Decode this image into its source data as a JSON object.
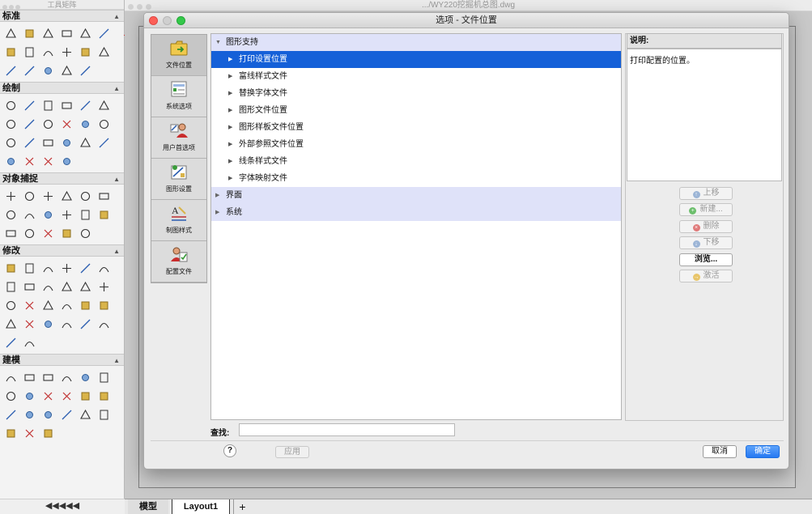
{
  "palette": {
    "title": "工具矩阵",
    "sections": [
      {
        "label": "标准",
        "rows": [
          [
            "new-file-icon",
            "open-folder-icon",
            "save-icon",
            "print-icon",
            "plot-icon",
            "print-preview-icon"
          ],
          [
            "cut-icon",
            "copy-icon",
            "paste-icon",
            "match-properties-icon",
            "undo-icon",
            "redo-icon"
          ],
          [
            "pan-icon",
            "orbit-icon",
            "zoom-realtime-icon",
            "design-center-icon",
            "block-editor-icon"
          ]
        ]
      },
      {
        "label": "绘制",
        "rows": [
          [
            "line-icon",
            "construction-line-icon",
            "circle-icon",
            "rectangle-icon",
            "revision-cloud-icon",
            "arc-icon"
          ],
          [
            "donut-icon",
            "ellipse-icon",
            "polyline-icon",
            "point-icon",
            "spline-icon",
            "multiline-icon"
          ],
          [
            "table-icon",
            "hatch-icon",
            "gradient-icon",
            "region-icon",
            "text-icon",
            "mtext-icon"
          ],
          [
            "wipeout-icon",
            "boundary-icon",
            "ellipse-arc-icon",
            "polygon-icon"
          ]
        ]
      },
      {
        "label": "对象捕捉",
        "rows": [
          [
            "snap-endpoint-icon",
            "snap-midpoint-icon",
            "snap-intersection-icon",
            "snap-apparent-icon",
            "snap-extension-icon",
            "snap-perpendicular-icon"
          ],
          [
            "snap-tangent-icon",
            "snap-center-icon",
            "snap-quadrant-icon",
            "snap-node-icon",
            "snap-insert-icon",
            "snap-nearest-icon"
          ],
          [
            "snap-parallel-icon",
            "snap-none-icon",
            "snap-from-icon",
            "snap-temp-icon",
            "snap-settings-icon"
          ]
        ]
      },
      {
        "label": "修改",
        "rows": [
          [
            "erase-icon",
            "copy-object-icon",
            "mirror-icon",
            "offset-icon",
            "array-icon",
            "fillet-icon"
          ],
          [
            "array-rect-icon",
            "move-icon",
            "rotate-icon",
            "scale-icon",
            "stretch-icon",
            "arc-edit-icon"
          ],
          [
            "trim-icon",
            "extend-icon",
            "break-icon",
            "join-icon",
            "text-edit-icon",
            "explode-icon"
          ],
          [
            "align-icon",
            "chamfer-icon",
            "hatch-edit-icon",
            "draworder-icon",
            "blend-icon",
            "smooth-icon"
          ],
          [
            "block-icon",
            "attribute-icon"
          ]
        ]
      },
      {
        "label": "建模",
        "rows": [
          [
            "box-icon",
            "cone-icon",
            "cylinder-icon",
            "pyramid-icon",
            "sphere-icon",
            "torus-icon"
          ],
          [
            "wedge-icon",
            "planar-surface-icon",
            "extrude-icon",
            "presspull-icon",
            "sweep-icon",
            "loft-icon"
          ],
          [
            "revolve-icon",
            "helix-icon",
            "union-icon",
            "subtract-icon",
            "intersect-icon",
            "section-icon"
          ],
          [
            "slice-icon",
            "interfere-icon",
            "render-icon"
          ]
        ]
      }
    ],
    "bottom": "◀◀◀◀◀"
  },
  "drawing_window": {
    "title": ".../WY220挖掘机总图.dwg",
    "tabs": {
      "model": "模型",
      "layout": "Layout1",
      "add": "+"
    }
  },
  "dialog": {
    "title": "选项 - 文件位置",
    "categories": [
      {
        "label": "文件位置",
        "icon": "folder-icon"
      },
      {
        "label": "系统选项",
        "icon": "system-options-icon"
      },
      {
        "label": "用户首选项",
        "icon": "user-preferences-icon"
      },
      {
        "label": "图形设置",
        "icon": "drawing-settings-icon"
      },
      {
        "label": "制图样式",
        "icon": "drafting-style-icon"
      },
      {
        "label": "配置文件",
        "icon": "profile-icon"
      }
    ],
    "tree": [
      {
        "label": "图形支持",
        "kind": "group",
        "expanded": true
      },
      {
        "label": "打印设置位置",
        "kind": "child",
        "selected": true
      },
      {
        "label": "富线样式文件",
        "kind": "child"
      },
      {
        "label": "替换字体文件",
        "kind": "child"
      },
      {
        "label": "图形文件位置",
        "kind": "child"
      },
      {
        "label": "图形样板文件位置",
        "kind": "child"
      },
      {
        "label": "外部参照文件位置",
        "kind": "child"
      },
      {
        "label": "线条样式文件",
        "kind": "child"
      },
      {
        "label": "字体映射文件",
        "kind": "child"
      },
      {
        "label": "界面",
        "kind": "group"
      },
      {
        "label": "系统",
        "kind": "group"
      }
    ],
    "description_label": "说明:",
    "description_text": "打印配置的位置。",
    "side_buttons": [
      {
        "label": "上移",
        "icon": "arrow-up-circle-icon",
        "enabled": false
      },
      {
        "label": "新建...",
        "icon": "plus-circle-icon",
        "enabled": false
      },
      {
        "label": "删除",
        "icon": "delete-circle-icon",
        "enabled": false
      },
      {
        "label": "下移",
        "icon": "arrow-down-circle-icon",
        "enabled": false
      },
      {
        "label": "浏览...",
        "icon": "",
        "enabled": true
      },
      {
        "label": "激活",
        "icon": "arrow-right-icon",
        "enabled": false
      }
    ],
    "find_label": "查找:",
    "find_value": "",
    "help": "?",
    "apply": "应用",
    "cancel": "取消",
    "ok": "确定"
  }
}
